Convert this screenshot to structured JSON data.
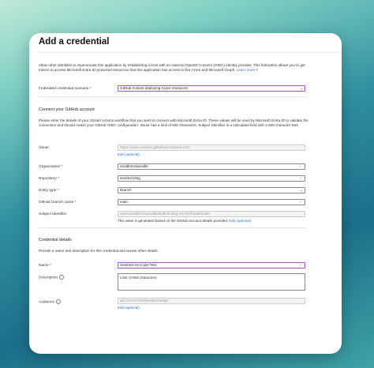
{
  "dialog": {
    "title": "Add a credential",
    "ellipsis": "···",
    "intro_text": "Allow other identities to impersonate this application by establishing a trust with an external OpenID Connect (OIDC) identity provider. This federation allows you to get tokens to access Microsoft Entra ID protected resources that this application has access to like Azure and Microsoft Graph.",
    "learn_more": "Learn more"
  },
  "scenario": {
    "label": "Federated credential scenario *",
    "value": "GitHub Actions deploying Azure resources"
  },
  "github": {
    "heading": "Connect your GitHub account",
    "description": "Please enter the details of your GitHub Actions workflow that you want to connect with Microsoft Entra ID. These values will be used by Microsoft Entra ID to validate the connection and should match your GitHub OIDC configuration. Issuer has a limit of 600 characters. Subject Identifier is a calculated field with a 600 character limit.",
    "issuer_label": "Issuer",
    "issuer_value": "https://token.actions.githubusercontent.com",
    "issuer_edit": "Edit (optional)",
    "org_label": "Organization *",
    "org_value": "noodlemctwoodle",
    "repo_label": "Repository *",
    "repo_value": "sentinel.blog",
    "entity_label": "Entity type *",
    "entity_value": "Branch",
    "branch_label": "GitHub branch name *",
    "branch_value": "main",
    "subject_label": "Subject identifier",
    "subject_value": "repo:noodlemctwoodle/sentinel.blog:ref:refs/heads/main",
    "subject_help": "This value is generated based on the GitHub account details provided.",
    "subject_edit": "Edit (optional)"
  },
  "credential": {
    "heading": "Credential details",
    "description": "Provide a name and description for this credential and review other details.",
    "name_label": "Name *",
    "name_value": "Sentinel-As-Code-Test",
    "desc_label": "Description",
    "desc_value": "Limit of 600 characters",
    "audience_label": "Audience",
    "audience_value": "api://AzureADTokenExchange",
    "audience_edit": "Edit (optional)"
  }
}
